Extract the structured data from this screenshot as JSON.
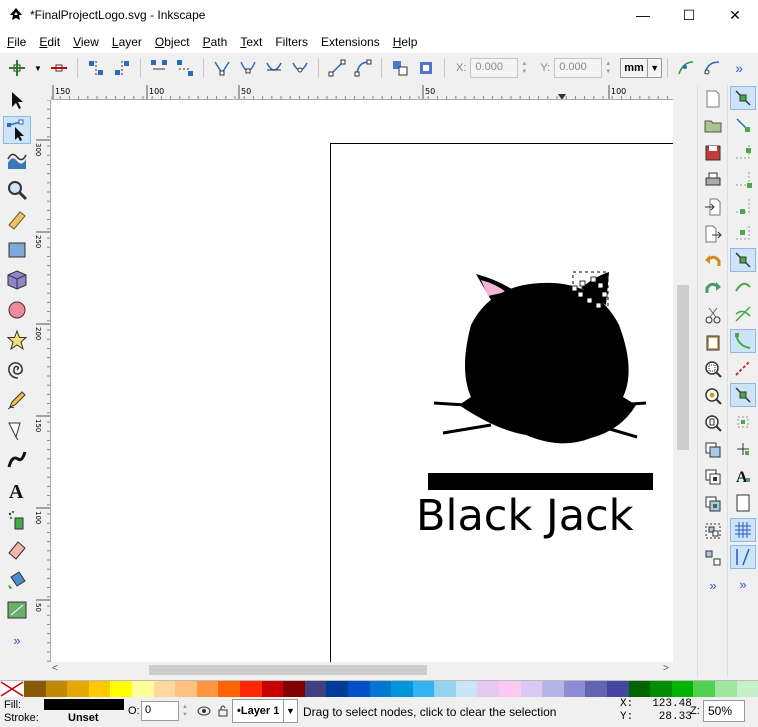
{
  "window": {
    "title": "*FinalProjectLogo.svg - Inkscape",
    "minimize": "—",
    "maximize": "☐",
    "close": "✕"
  },
  "menu": [
    {
      "label": "File",
      "u": "F",
      "rest": "ile"
    },
    {
      "label": "Edit",
      "u": "E",
      "rest": "dit"
    },
    {
      "label": "View",
      "u": "V",
      "rest": "iew"
    },
    {
      "label": "Layer",
      "u": "L",
      "rest": "ayer"
    },
    {
      "label": "Object",
      "u": "O",
      "rest": "bject"
    },
    {
      "label": "Path",
      "u": "P",
      "rest": "ath"
    },
    {
      "label": "Text",
      "u": "T",
      "rest": "ext"
    },
    {
      "label": "Filters",
      "u": "",
      "rest": "Filters"
    },
    {
      "label": "Extensions",
      "u": "",
      "rest": "Extensions"
    },
    {
      "label": "Help",
      "u": "H",
      "rest": "elp"
    }
  ],
  "node_toolbar": {
    "x_label": "X:",
    "x_value": "0.000",
    "y_label": "Y:",
    "y_value": "0.000",
    "unit": "mm",
    "overflow": "»"
  },
  "ruler_top": [
    "150",
    "100",
    "50",
    "0",
    "50",
    "100"
  ],
  "ruler_left": [
    "300",
    "250",
    "200",
    "150",
    "100",
    "50"
  ],
  "canvas": {
    "logo_text": "Black Jack"
  },
  "colors": {
    "accent": "#cde3f7",
    "ear_inner": "#f3b6d9",
    "palette": [
      "#8a5a00",
      "#c08a00",
      "#e6a800",
      "#ffc800",
      "#ffff00",
      "#ffff99",
      "#ffd8a0",
      "#ffc080",
      "#ff9640",
      "#ff6400",
      "#ff2800",
      "#c80000",
      "#800000",
      "#404080",
      "#003c96",
      "#0050c8",
      "#0078d2",
      "#0096dc",
      "#32b4f0",
      "#96d2f0",
      "#c8e6f5",
      "#e6c8f0",
      "#ffc8f0",
      "#dcc8f5",
      "#b4b4e6",
      "#8c8cd2",
      "#6464b4",
      "#4646a0",
      "#006400",
      "#008c00",
      "#00b400",
      "#50d250",
      "#a0e6a0",
      "#c8f0c8"
    ]
  },
  "status": {
    "fill_label": "Fill:",
    "stroke_label": "Stroke:",
    "stroke_value": "Unset",
    "opacity_label": "O:",
    "opacity_value": "0",
    "layer": "•Layer 1",
    "message": "Drag to select nodes, click to clear the selection",
    "x_label": "X:",
    "x_value": "123.48",
    "y_label": "Y:",
    "y_value": "28.33",
    "zoom_label": "Z:",
    "zoom_value": "50%"
  }
}
